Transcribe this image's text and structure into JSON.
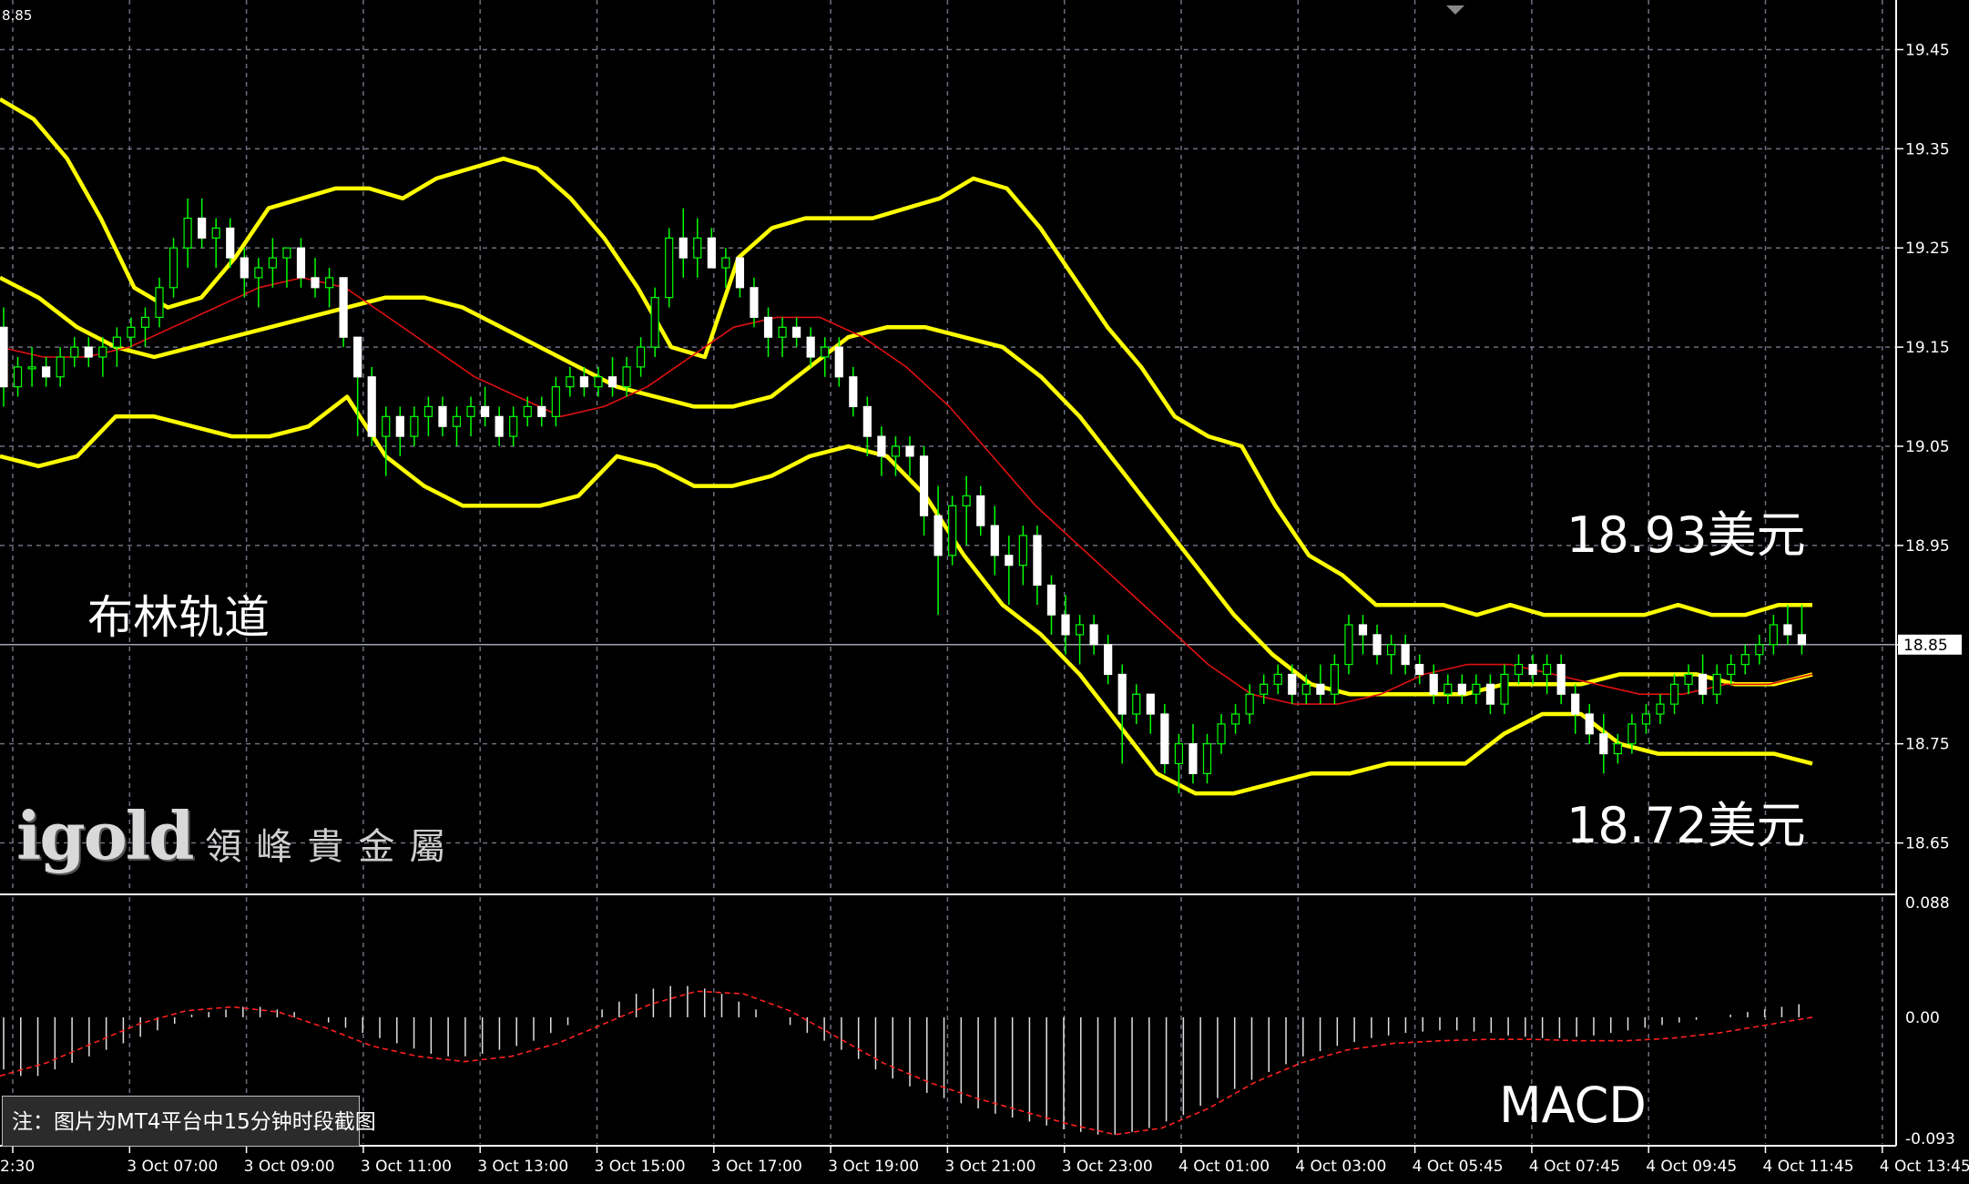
{
  "chart_data": {
    "type": "candlestick",
    "platform_note": "注：图片为MT4平台中15分钟时段截图",
    "top_left_value": "8.85",
    "price_axis": {
      "ylim": [
        18.6,
        19.5
      ],
      "ticks": [
        "19.45",
        "19.35",
        "19.25",
        "19.15",
        "19.05",
        "18.95",
        "18.85",
        "18.75",
        "18.65"
      ]
    },
    "current_price": "18.85",
    "macd_axis": {
      "ylim": [
        -0.093,
        0.088
      ],
      "ticks": [
        "0.088",
        "0.00",
        "-0.093"
      ]
    },
    "x_tick_labels": [
      "2:30",
      "3 Oct 07:00",
      "3 Oct 09:00",
      "3 Oct 11:00",
      "3 Oct 13:00",
      "3 Oct 15:00",
      "3 Oct 17:00",
      "3 Oct 19:00",
      "3 Oct 21:00",
      "3 Oct 23:00",
      "4 Oct 01:00",
      "4 Oct 03:00",
      "4 Oct 05:45",
      "4 Oct 07:45",
      "4 Oct 09:45",
      "4 Oct 11:45",
      "4 Oct 13:45"
    ],
    "annotations": {
      "bollinger_label": "布林轨道",
      "upper_level": "18.93美元",
      "lower_level": "18.72美元",
      "macd_label": "MACD"
    },
    "logo": {
      "brand": "igold",
      "chinese": "領峰貴金屬"
    },
    "colors": {
      "bull_candle": "#00ff00",
      "bollinger": "#ffff00",
      "moving_average": "#e01010",
      "macd_hist": "#e0e0e0",
      "macd_signal": "#ff2020",
      "grid": "#6c7080",
      "axis_text": "#ffffff"
    },
    "candles": [
      [
        19.17,
        19.19,
        19.09,
        19.11
      ],
      [
        19.11,
        19.14,
        19.1,
        19.13
      ],
      [
        19.13,
        19.15,
        19.11,
        19.13
      ],
      [
        19.13,
        19.14,
        19.11,
        19.12
      ],
      [
        19.12,
        19.15,
        19.11,
        19.14
      ],
      [
        19.14,
        19.16,
        19.13,
        19.15
      ],
      [
        19.15,
        19.16,
        19.13,
        19.14
      ],
      [
        19.14,
        19.16,
        19.12,
        19.15
      ],
      [
        19.15,
        19.17,
        19.13,
        19.16
      ],
      [
        19.16,
        19.18,
        19.15,
        19.17
      ],
      [
        19.17,
        19.19,
        19.15,
        19.18
      ],
      [
        19.18,
        19.22,
        19.17,
        19.21
      ],
      [
        19.21,
        19.26,
        19.2,
        19.25
      ],
      [
        19.25,
        19.3,
        19.23,
        19.28
      ],
      [
        19.28,
        19.3,
        19.25,
        19.26
      ],
      [
        19.26,
        19.28,
        19.23,
        19.27
      ],
      [
        19.27,
        19.28,
        19.23,
        19.24
      ],
      [
        19.24,
        19.25,
        19.2,
        19.22
      ],
      [
        19.22,
        19.24,
        19.19,
        19.23
      ],
      [
        19.23,
        19.26,
        19.21,
        19.24
      ],
      [
        19.24,
        19.25,
        19.21,
        19.25
      ],
      [
        19.25,
        19.26,
        19.21,
        19.22
      ],
      [
        19.22,
        19.24,
        19.2,
        19.21
      ],
      [
        19.21,
        19.23,
        19.19,
        19.22
      ],
      [
        19.22,
        19.22,
        19.15,
        19.16
      ],
      [
        19.16,
        19.16,
        19.06,
        19.12
      ],
      [
        19.12,
        19.13,
        19.05,
        19.06
      ],
      [
        19.06,
        19.09,
        19.02,
        19.08
      ],
      [
        19.08,
        19.09,
        19.04,
        19.06
      ],
      [
        19.06,
        19.09,
        19.05,
        19.08
      ],
      [
        19.08,
        19.1,
        19.06,
        19.09
      ],
      [
        19.09,
        19.1,
        19.06,
        19.07
      ],
      [
        19.07,
        19.09,
        19.05,
        19.08
      ],
      [
        19.08,
        19.1,
        19.06,
        19.09
      ],
      [
        19.09,
        19.11,
        19.07,
        19.08
      ],
      [
        19.08,
        19.09,
        19.05,
        19.06
      ],
      [
        19.06,
        19.09,
        19.05,
        19.08
      ],
      [
        19.08,
        19.1,
        19.07,
        19.09
      ],
      [
        19.09,
        19.1,
        19.07,
        19.08
      ],
      [
        19.08,
        19.12,
        19.07,
        19.11
      ],
      [
        19.11,
        19.13,
        19.1,
        19.12
      ],
      [
        19.12,
        19.13,
        19.1,
        19.11
      ],
      [
        19.11,
        19.13,
        19.1,
        19.12
      ],
      [
        19.12,
        19.14,
        19.1,
        19.11
      ],
      [
        19.11,
        19.14,
        19.1,
        19.13
      ],
      [
        19.13,
        19.16,
        19.12,
        19.15
      ],
      [
        19.15,
        19.21,
        19.14,
        19.2
      ],
      [
        19.2,
        19.27,
        19.19,
        19.26
      ],
      [
        19.26,
        19.29,
        19.22,
        19.24
      ],
      [
        19.24,
        19.28,
        19.22,
        19.26
      ],
      [
        19.26,
        19.27,
        19.23,
        19.23
      ],
      [
        19.23,
        19.25,
        19.21,
        19.24
      ],
      [
        19.24,
        19.24,
        19.2,
        19.21
      ],
      [
        19.21,
        19.22,
        19.17,
        19.18
      ],
      [
        19.18,
        19.19,
        19.14,
        19.16
      ],
      [
        19.16,
        19.18,
        19.14,
        19.17
      ],
      [
        19.17,
        19.18,
        19.15,
        19.16
      ],
      [
        19.16,
        19.17,
        19.13,
        19.14
      ],
      [
        19.14,
        19.16,
        19.12,
        19.15
      ],
      [
        19.15,
        19.16,
        19.11,
        19.12
      ],
      [
        19.12,
        19.13,
        19.08,
        19.09
      ],
      [
        19.09,
        19.1,
        19.04,
        19.06
      ],
      [
        19.06,
        19.07,
        19.02,
        19.04
      ],
      [
        19.04,
        19.06,
        19.02,
        19.05
      ],
      [
        19.05,
        19.06,
        19.02,
        19.04
      ],
      [
        19.04,
        19.05,
        18.96,
        18.98
      ],
      [
        18.98,
        19.01,
        18.88,
        18.94
      ],
      [
        18.94,
        19.0,
        18.93,
        18.99
      ],
      [
        18.99,
        19.02,
        18.95,
        19.0
      ],
      [
        19.0,
        19.01,
        18.96,
        18.97
      ],
      [
        18.97,
        18.99,
        18.92,
        18.94
      ],
      [
        18.94,
        18.96,
        18.89,
        18.93
      ],
      [
        18.93,
        18.97,
        18.91,
        18.96
      ],
      [
        18.96,
        18.97,
        18.89,
        18.91
      ],
      [
        18.91,
        18.92,
        18.86,
        18.88
      ],
      [
        18.88,
        18.9,
        18.84,
        18.86
      ],
      [
        18.86,
        18.88,
        18.83,
        18.87
      ],
      [
        18.87,
        18.88,
        18.84,
        18.85
      ],
      [
        18.85,
        18.86,
        18.81,
        18.82
      ],
      [
        18.82,
        18.83,
        18.73,
        18.78
      ],
      [
        18.78,
        18.81,
        18.77,
        18.8
      ],
      [
        18.8,
        18.8,
        18.76,
        18.78
      ],
      [
        18.78,
        18.79,
        18.72,
        18.73
      ],
      [
        18.73,
        18.76,
        18.7,
        18.75
      ],
      [
        18.75,
        18.77,
        18.71,
        18.72
      ],
      [
        18.72,
        18.76,
        18.71,
        18.75
      ],
      [
        18.75,
        18.78,
        18.74,
        18.77
      ],
      [
        18.77,
        18.79,
        18.76,
        18.78
      ],
      [
        18.78,
        18.81,
        18.77,
        18.8
      ],
      [
        18.8,
        18.82,
        18.79,
        18.81
      ],
      [
        18.81,
        18.83,
        18.8,
        18.82
      ],
      [
        18.82,
        18.83,
        18.79,
        18.8
      ],
      [
        18.8,
        18.82,
        18.79,
        18.81
      ],
      [
        18.81,
        18.83,
        18.79,
        18.8
      ],
      [
        18.8,
        18.84,
        18.79,
        18.83
      ],
      [
        18.83,
        18.88,
        18.82,
        18.87
      ],
      [
        18.87,
        18.88,
        18.84,
        18.86
      ],
      [
        18.86,
        18.87,
        18.83,
        18.84
      ],
      [
        18.84,
        18.86,
        18.82,
        18.85
      ],
      [
        18.85,
        18.86,
        18.82,
        18.83
      ],
      [
        18.83,
        18.84,
        18.81,
        18.82
      ],
      [
        18.82,
        18.83,
        18.79,
        18.8
      ],
      [
        18.8,
        18.82,
        18.79,
        18.81
      ],
      [
        18.81,
        18.82,
        18.79,
        18.8
      ],
      [
        18.8,
        18.82,
        18.79,
        18.81
      ],
      [
        18.81,
        18.82,
        18.78,
        18.79
      ],
      [
        18.79,
        18.83,
        18.78,
        18.82
      ],
      [
        18.82,
        18.84,
        18.81,
        18.83
      ],
      [
        18.83,
        18.84,
        18.81,
        18.82
      ],
      [
        18.82,
        18.84,
        18.8,
        18.83
      ],
      [
        18.83,
        18.84,
        18.79,
        18.8
      ],
      [
        18.8,
        18.81,
        18.76,
        18.78
      ],
      [
        18.78,
        18.79,
        18.75,
        18.76
      ],
      [
        18.76,
        18.78,
        18.72,
        18.74
      ],
      [
        18.74,
        18.76,
        18.73,
        18.75
      ],
      [
        18.75,
        18.78,
        18.74,
        18.77
      ],
      [
        18.77,
        18.79,
        18.76,
        18.78
      ],
      [
        18.78,
        18.8,
        18.77,
        18.79
      ],
      [
        18.79,
        18.82,
        18.78,
        18.81
      ],
      [
        18.81,
        18.83,
        18.8,
        18.82
      ],
      [
        18.82,
        18.84,
        18.79,
        18.8
      ],
      [
        18.8,
        18.83,
        18.79,
        18.82
      ],
      [
        18.82,
        18.84,
        18.81,
        18.83
      ],
      [
        18.83,
        18.85,
        18.82,
        18.84
      ],
      [
        18.84,
        18.86,
        18.83,
        18.85
      ],
      [
        18.85,
        18.88,
        18.84,
        18.87
      ],
      [
        18.87,
        18.89,
        18.85,
        18.86
      ],
      [
        18.86,
        18.89,
        18.84,
        18.85
      ]
    ],
    "bollinger_upper": [
      19.4,
      19.38,
      19.34,
      19.28,
      19.21,
      19.19,
      19.2,
      19.24,
      19.29,
      19.3,
      19.31,
      19.31,
      19.3,
      19.32,
      19.33,
      19.34,
      19.33,
      19.3,
      19.26,
      19.21,
      19.15,
      19.14,
      19.24,
      19.27,
      19.28,
      19.28,
      19.28,
      19.29,
      19.3,
      19.32,
      19.31,
      19.27,
      19.22,
      19.17,
      19.13,
      19.08,
      19.06,
      19.05,
      18.99,
      18.94,
      18.92,
      18.89,
      18.89,
      18.89,
      18.88,
      18.89,
      18.88,
      18.88,
      18.88,
      18.88,
      18.89,
      18.88,
      18.88,
      18.89,
      18.89
    ],
    "bollinger_middle": [
      19.22,
      19.2,
      19.17,
      19.15,
      19.14,
      19.15,
      19.16,
      19.17,
      19.18,
      19.19,
      19.2,
      19.2,
      19.19,
      19.17,
      19.15,
      19.13,
      19.11,
      19.1,
      19.09,
      19.09,
      19.1,
      19.13,
      19.16,
      19.17,
      19.17,
      19.16,
      19.15,
      19.12,
      19.08,
      19.03,
      18.98,
      18.93,
      18.88,
      18.84,
      18.81,
      18.8,
      18.8,
      18.8,
      18.8,
      18.81,
      18.81,
      18.81,
      18.82,
      18.82,
      18.82,
      18.81,
      18.81,
      18.82
    ],
    "bollinger_lower": [
      19.04,
      19.03,
      19.04,
      19.08,
      19.08,
      19.07,
      19.06,
      19.06,
      19.07,
      19.1,
      19.04,
      19.01,
      18.99,
      18.99,
      18.99,
      19.0,
      19.04,
      19.03,
      19.01,
      19.01,
      19.02,
      19.04,
      19.05,
      19.04,
      19.0,
      18.94,
      18.89,
      18.86,
      18.82,
      18.77,
      18.72,
      18.7,
      18.7,
      18.71,
      18.72,
      18.72,
      18.73,
      18.73,
      18.73,
      18.76,
      18.78,
      18.78,
      18.75,
      18.74,
      18.74,
      18.74,
      18.74,
      18.73
    ],
    "moving_average": [
      19.15,
      19.14,
      19.14,
      19.15,
      19.17,
      19.19,
      19.21,
      19.22,
      19.21,
      19.18,
      19.15,
      19.12,
      19.1,
      19.08,
      19.09,
      19.11,
      19.14,
      19.17,
      19.18,
      19.18,
      19.16,
      19.13,
      19.09,
      19.04,
      18.99,
      18.95,
      18.91,
      18.87,
      18.83,
      18.8,
      18.79,
      18.79,
      18.8,
      18.82,
      18.83,
      18.83,
      18.82,
      18.81,
      18.8,
      18.8,
      18.81,
      18.81,
      18.82
    ],
    "macd_histogram": [
      -0.04,
      -0.045,
      -0.045,
      -0.04,
      -0.035,
      -0.03,
      -0.025,
      -0.02,
      -0.015,
      -0.01,
      -0.005,
      0.002,
      0.004,
      0.006,
      0.008,
      0.008,
      0.006,
      0.004,
      0.0,
      -0.004,
      -0.008,
      -0.012,
      -0.016,
      -0.02,
      -0.024,
      -0.028,
      -0.03,
      -0.03,
      -0.028,
      -0.025,
      -0.022,
      -0.018,
      -0.012,
      -0.006,
      0.0,
      0.006,
      0.012,
      0.018,
      0.022,
      0.024,
      0.024,
      0.022,
      0.018,
      0.012,
      0.006,
      0.0,
      -0.006,
      -0.012,
      -0.018,
      -0.025,
      -0.032,
      -0.04,
      -0.047,
      -0.053,
      -0.058,
      -0.062,
      -0.066,
      -0.07,
      -0.074,
      -0.077,
      -0.08,
      -0.083,
      -0.086,
      -0.088,
      -0.09,
      -0.09,
      -0.088,
      -0.085,
      -0.08,
      -0.075,
      -0.068,
      -0.062,
      -0.055,
      -0.048,
      -0.042,
      -0.036,
      -0.03,
      -0.026,
      -0.022,
      -0.019,
      -0.016,
      -0.014,
      -0.012,
      -0.011,
      -0.01,
      -0.01,
      -0.011,
      -0.012,
      -0.014,
      -0.015,
      -0.016,
      -0.016,
      -0.015,
      -0.014,
      -0.012,
      -0.01,
      -0.008,
      -0.006,
      -0.004,
      -0.002,
      0.0,
      0.002,
      0.004,
      0.006,
      0.008,
      0.01
    ],
    "macd_signal": [
      -0.045,
      -0.035,
      -0.02,
      -0.005,
      0.005,
      0.008,
      0.004,
      -0.008,
      -0.022,
      -0.03,
      -0.034,
      -0.03,
      -0.02,
      -0.005,
      0.01,
      0.02,
      0.018,
      0.005,
      -0.015,
      -0.035,
      -0.05,
      -0.062,
      -0.072,
      -0.082,
      -0.09,
      -0.085,
      -0.07,
      -0.05,
      -0.035,
      -0.025,
      -0.02,
      -0.018,
      -0.017,
      -0.017,
      -0.018,
      -0.018,
      -0.016,
      -0.012,
      -0.006,
      0.0
    ]
  }
}
